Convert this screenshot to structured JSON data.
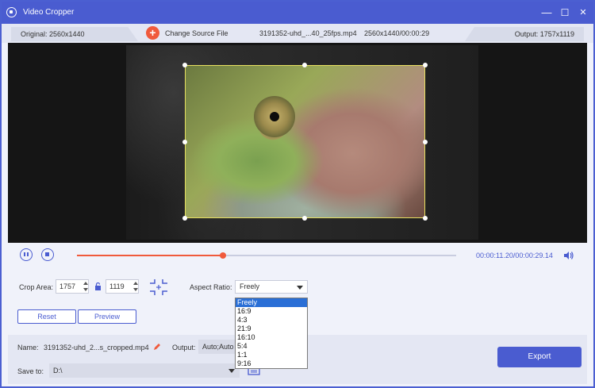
{
  "window": {
    "title": "Video Cropper",
    "controls": {
      "minimize": "—",
      "maximize": "☐",
      "close": "✕"
    }
  },
  "infobar": {
    "original": "Original: 2560x1440",
    "change_source": "Change Source File",
    "file_name": "3191352-uhd_...40_25fps.mp4",
    "file_res_time": "2560x1440/00:00:29",
    "output": "Output: 1757x1119"
  },
  "playback": {
    "current_time": "00:00:11.20",
    "total_time": "/00:00:29.14",
    "progress_percent": 38.5
  },
  "crop": {
    "label": "Crop Area:",
    "width": "1757",
    "height": "1119",
    "aspect_label": "Aspect Ratio:",
    "aspect_value": "Freely",
    "aspect_options": [
      "Freely",
      "16:9",
      "4:3",
      "21:9",
      "16:10",
      "5:4",
      "1:1",
      "9:16"
    ]
  },
  "buttons": {
    "reset": "Reset",
    "preview": "Preview",
    "export": "Export"
  },
  "output_settings": {
    "name_label": "Name:",
    "name_value": "3191352-uhd_2...s_cropped.mp4",
    "output_label": "Output:",
    "output_value": "Auto;Auto",
    "save_label": "Save to:",
    "save_value": "D:\\"
  },
  "colors": {
    "accent": "#4a5cd0",
    "progress": "#f05a3c",
    "crop_border": "#e8e060"
  }
}
